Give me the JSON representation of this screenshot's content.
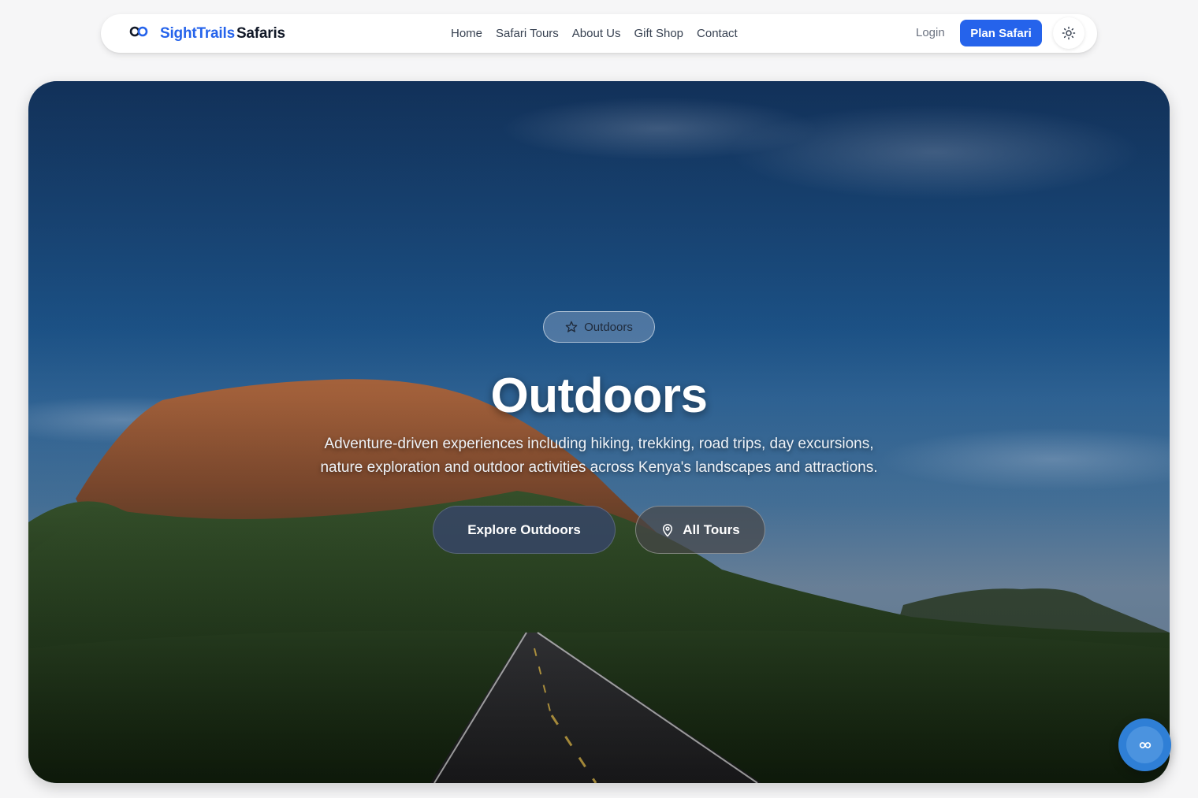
{
  "brand": {
    "name_part1": "SightTrails",
    "name_part2": "Safaris",
    "icon": "infinity-logo-icon"
  },
  "nav": {
    "links": [
      "Home",
      "Safari Tours",
      "About Us",
      "Gift Shop",
      "Contact"
    ],
    "login_label": "Login",
    "plan_label": "Plan Safari",
    "theme_icon": "sun-icon"
  },
  "hero": {
    "badge_label": "Outdoors",
    "badge_icon": "star-icon",
    "title": "Outdoors",
    "description": "Adventure-driven experiences including hiking, trekking, road trips, day excursions, nature exploration and outdoor activities across Kenya's landscapes and attractions.",
    "primary_button": "Explore Outdoors",
    "secondary_button": "All Tours",
    "secondary_icon": "map-pin-icon"
  },
  "floating_button": {
    "icon": "infinity-chat-icon"
  },
  "colors": {
    "accent": "#2563eb",
    "fab": "#2f7fd6"
  }
}
